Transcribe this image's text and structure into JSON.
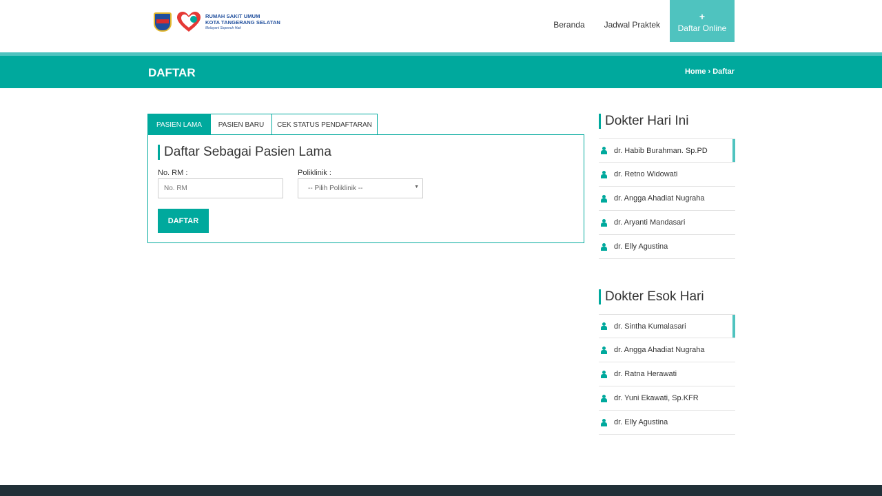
{
  "header": {
    "logo": {
      "line1": "RUMAH SAKIT UMUM",
      "line2": "KOTA TANGERANG SELATAN",
      "line3": "Melayani Sepenuh Hati"
    },
    "nav": [
      {
        "label": "Beranda"
      },
      {
        "label": "Jadwal Praktek"
      },
      {
        "label": "Daftar Online",
        "icon": "+"
      }
    ]
  },
  "titlebar": {
    "title": "DAFTAR",
    "breadcrumb": {
      "home": "Home",
      "separator": "›",
      "current": "Daftar"
    }
  },
  "tabs": [
    {
      "label": "PASIEN LAMA"
    },
    {
      "label": "PASIEN BARU"
    },
    {
      "label": "CEK STATUS PENDAFTARAN"
    }
  ],
  "form": {
    "title": "Daftar Sebagai Pasien Lama",
    "rm_label": "No. RM :",
    "rm_placeholder": "No. RM",
    "poli_label": "Poliklinik :",
    "poli_selected": "-- Pilih Poliklinik --",
    "submit": "DAFTAR"
  },
  "sidebar": {
    "today": {
      "title": "Dokter Hari Ini",
      "doctors": [
        "dr. Habib Burahman. Sp.PD",
        "dr. Retno Widowati",
        "dr. Angga Ahadiat Nugraha",
        "dr. Aryanti Mandasari",
        "dr. Elly Agustina"
      ]
    },
    "tomorrow": {
      "title": "Dokter Esok Hari",
      "doctors": [
        "dr. Sintha Kumalasari",
        "dr. Angga Ahadiat Nugraha",
        "dr. Ratna Herawati",
        "dr. Yuni Ekawati, Sp.KFR",
        "dr. Elly Agustina"
      ]
    }
  },
  "colors": {
    "primary": "#00a99d",
    "accent": "#4fc3bf",
    "footer": "#213038"
  }
}
